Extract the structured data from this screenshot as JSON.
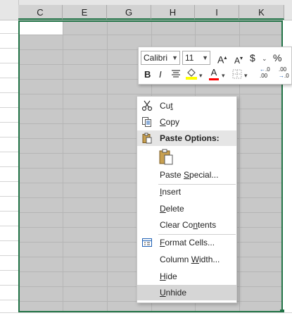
{
  "columns": [
    {
      "label": "C"
    },
    {
      "label": "E"
    },
    {
      "label": "G"
    },
    {
      "label": "H"
    },
    {
      "label": "I"
    },
    {
      "label": "K"
    }
  ],
  "mini_toolbar": {
    "font_name": "Calibri",
    "font_size": "11",
    "grow_font": "A",
    "shrink_font": "A",
    "currency": "$",
    "percent": "%",
    "bold": "B",
    "italic": "I",
    "font_color": "A",
    "inc_decimal": ".00",
    "dec_decimal": ".0"
  },
  "context_menu": {
    "cut": {
      "pre": "Cu",
      "u": "t",
      "post": ""
    },
    "copy": {
      "pre": "",
      "u": "C",
      "post": "opy"
    },
    "paste_options": "Paste Options:",
    "paste_special": {
      "pre": "Paste ",
      "u": "S",
      "post": "pecial..."
    },
    "insert": {
      "pre": "",
      "u": "I",
      "post": "nsert"
    },
    "delete": {
      "pre": "",
      "u": "D",
      "post": "elete"
    },
    "clear_contents": {
      "pre": "Clear Co",
      "u": "n",
      "post": "tents"
    },
    "format_cells": {
      "pre": "",
      "u": "F",
      "post": "ormat Cells..."
    },
    "column_width": {
      "pre": "Column ",
      "u": "W",
      "post": "idth..."
    },
    "hide": {
      "pre": "",
      "u": "H",
      "post": "ide"
    },
    "unhide": {
      "pre": "",
      "u": "U",
      "post": "nhide"
    }
  },
  "colors": {
    "selection_border": "#217346",
    "selection_fill": "#c8c8c8",
    "highlight_yellow": "#ffff00",
    "font_red": "#ff0000"
  }
}
